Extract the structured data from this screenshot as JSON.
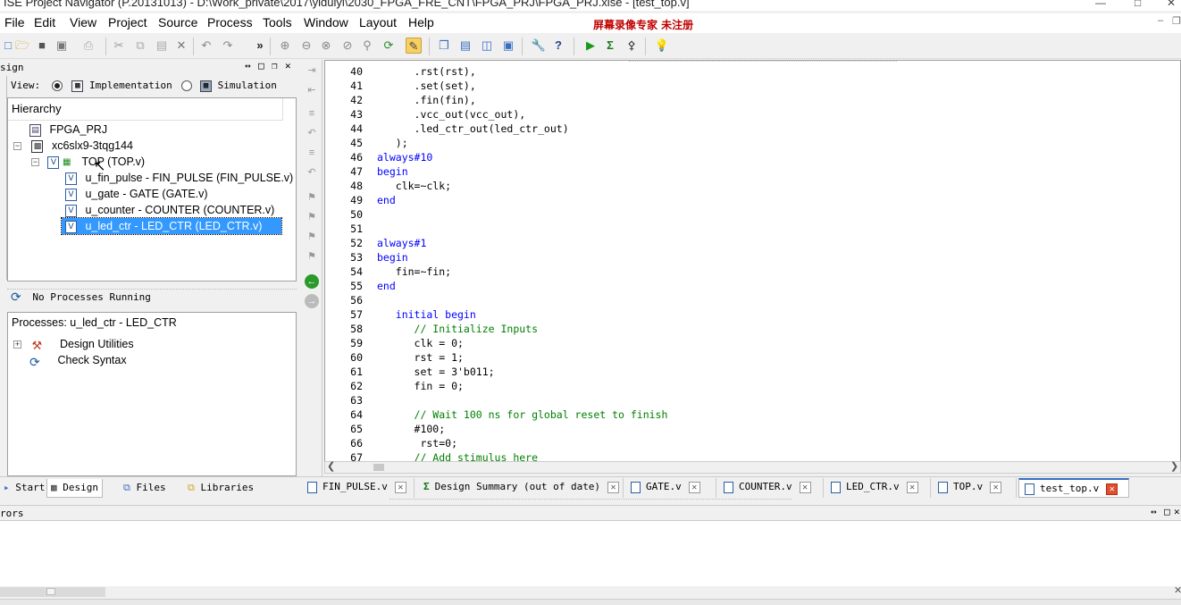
{
  "window": {
    "title": "ISE Project Navigator (P.20131013) - D:\\Work_private\\2017\\yiduiyi\\2030_FPGA_FRE_CNT\\FPGA_PRJ\\FPGA_PRJ.xise - [test_top.v]"
  },
  "watermark": "屏幕录像专家  未注册",
  "menu": [
    "File",
    "Edit",
    "View",
    "Project",
    "Source",
    "Process",
    "Tools",
    "Window",
    "Layout",
    "Help"
  ],
  "design_panel": {
    "title": "sign",
    "view_label": "View:",
    "implementation_label": "Implementation",
    "simulation_label": "Simulation",
    "hierarchy_label": "Hierarchy",
    "tree": [
      {
        "label": "FPGA_PRJ"
      },
      {
        "label": "xc6slx9-3tqg144"
      },
      {
        "label": "TOP (TOP.v)"
      },
      {
        "label": "u_fin_pulse - FIN_PULSE (FIN_PULSE.v)"
      },
      {
        "label": "u_gate - GATE (GATE.v)"
      },
      {
        "label": "u_counter - COUNTER (COUNTER.v)"
      },
      {
        "label": "u_led_ctr - LED_CTR (LED_CTR.v)"
      }
    ],
    "processes_status": "No Processes Running",
    "processes_label": "Processes: u_led_ctr - LED_CTR",
    "processes": [
      {
        "label": "Design Utilities"
      },
      {
        "label": "Check Syntax"
      }
    ]
  },
  "left_tabs": [
    "Start",
    "Design",
    "Files",
    "Libraries"
  ],
  "editor": {
    "lines": [
      {
        "n": "40",
        "code": "      .rst(rst),"
      },
      {
        "n": "41",
        "code": "      .set(set),"
      },
      {
        "n": "42",
        "code": "      .fin(fin),"
      },
      {
        "n": "43",
        "code": "      .vcc_out(vcc_out),"
      },
      {
        "n": "44",
        "code": "      .led_ctr_out(led_ctr_out)"
      },
      {
        "n": "45",
        "code": "   );"
      },
      {
        "n": "46",
        "code": "always#10"
      },
      {
        "n": "47",
        "code": "begin"
      },
      {
        "n": "48",
        "code": "   clk=~clk;"
      },
      {
        "n": "49",
        "code": "end"
      },
      {
        "n": "50",
        "code": ""
      },
      {
        "n": "51",
        "code": ""
      },
      {
        "n": "52",
        "code": "always#1"
      },
      {
        "n": "53",
        "code": "begin"
      },
      {
        "n": "54",
        "code": "   fin=~fin;"
      },
      {
        "n": "55",
        "code": "end"
      },
      {
        "n": "56",
        "code": ""
      },
      {
        "n": "57",
        "code": "   initial begin"
      },
      {
        "n": "58",
        "code": "      // Initialize Inputs"
      },
      {
        "n": "59",
        "code": "      clk = 0;"
      },
      {
        "n": "60",
        "code": "      rst = 1;"
      },
      {
        "n": "61",
        "code": "      set = 3'b011;"
      },
      {
        "n": "62",
        "code": "      fin = 0;"
      },
      {
        "n": "63",
        "code": ""
      },
      {
        "n": "64",
        "code": "      // Wait 100 ns for global reset to finish"
      },
      {
        "n": "65",
        "code": "      #100;"
      },
      {
        "n": "66",
        "code": "       rst=0;"
      },
      {
        "n": "67",
        "code": "      // Add stimulus here"
      }
    ]
  },
  "file_tabs": [
    {
      "label": "FIN_PULSE.v"
    },
    {
      "label": "Design Summary (out of date)"
    },
    {
      "label": "GATE.v"
    },
    {
      "label": "COUNTER.v"
    },
    {
      "label": "LED_CTR.v"
    },
    {
      "label": "TOP.v"
    },
    {
      "label": "test_top.v"
    }
  ],
  "errors_panel": {
    "title": "rors"
  }
}
